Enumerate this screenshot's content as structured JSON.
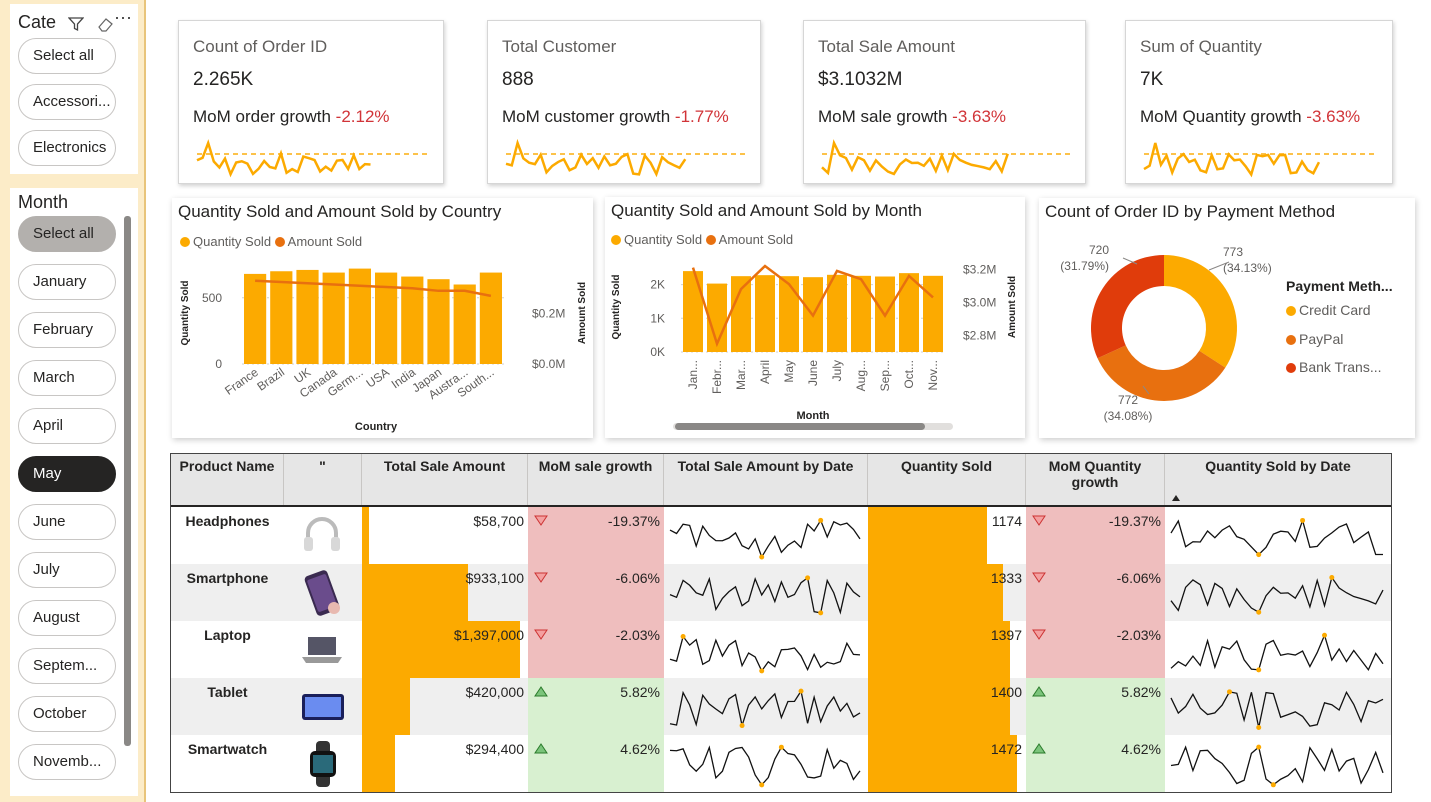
{
  "slicer_category": {
    "title": "Cate",
    "items": [
      "Select all",
      "Accessori...",
      "Electronics"
    ]
  },
  "slicer_month": {
    "title": "Month",
    "items": [
      "Select all",
      "January",
      "February",
      "March",
      "April",
      "May",
      "June",
      "July",
      "August",
      "Septem...",
      "October",
      "Novemb..."
    ],
    "selected": "May"
  },
  "cards": [
    {
      "label": "Count of Order ID",
      "value": "2.265K",
      "growth_label": "MoM order growth",
      "growth": "-2.12%"
    },
    {
      "label": "Total Customer",
      "value": "888",
      "growth_label": "MoM customer growth",
      "growth": "-1.77%"
    },
    {
      "label": "Total Sale Amount",
      "value": "$3.1032M",
      "growth_label": "MoM sale growth",
      "growth": "-3.63%"
    },
    {
      "label": "Sum of Quantity",
      "value": "7K",
      "growth_label": "MoM Quantity growth",
      "growth": "-3.63%"
    }
  ],
  "colors": {
    "quantity": "#fcaa00",
    "amount": "#e8700f",
    "bank": "#e03c0b",
    "neg": "#d13438",
    "neg_bg": "#efbebe",
    "pos_bg": "#d8f0d0"
  },
  "chart_country": {
    "title": "Quantity Sold and Amount Sold by Country",
    "legend": [
      "Quantity Sold",
      "Amount Sold"
    ],
    "xlabel": "Country",
    "ylabel_left": "Quantity Sold",
    "ylabel_right": "Amount Sold",
    "left_ticks": [
      "0",
      "500"
    ],
    "right_ticks": [
      "$0.0M",
      "$0.2M"
    ],
    "chart_data": {
      "type": "bar",
      "categories": [
        "France",
        "Brazil",
        "UK",
        "Canada",
        "Germ...",
        "USA",
        "India",
        "Japan",
        "Austra...",
        "South..."
      ],
      "series": [
        {
          "name": "Quantity Sold",
          "values": [
            680,
            700,
            710,
            690,
            720,
            690,
            660,
            640,
            600,
            690
          ]
        },
        {
          "name": "Amount Sold",
          "values": [
            0.33,
            0.325,
            0.32,
            0.315,
            0.31,
            0.305,
            0.3,
            0.29,
            0.29,
            0.27
          ]
        }
      ]
    }
  },
  "chart_month": {
    "title": "Quantity Sold and Amount Sold by Month",
    "legend": [
      "Quantity Sold",
      "Amount Sold"
    ],
    "xlabel": "Month",
    "ylabel_left": "Quantity Sold",
    "ylabel_right": "Amount Sold",
    "left_ticks": [
      "0K",
      "1K",
      "2K"
    ],
    "right_ticks": [
      "$2.8M",
      "$3.0M",
      "$3.2M"
    ],
    "chart_data": {
      "type": "bar",
      "categories": [
        "Jan...",
        "Febr...",
        "Mar...",
        "April",
        "May",
        "June",
        "July",
        "Aug...",
        "Sep...",
        "Oct...",
        "Nov..."
      ],
      "series": [
        {
          "name": "Quantity Sold",
          "values": [
            2400,
            2030,
            2250,
            2280,
            2250,
            2220,
            2290,
            2260,
            2240,
            2340,
            2260
          ]
        },
        {
          "name": "Amount Sold",
          "values": [
            3.21,
            2.75,
            3.08,
            3.22,
            3.11,
            2.92,
            3.19,
            3.14,
            2.92,
            3.16,
            3.03
          ]
        }
      ]
    }
  },
  "chart_payment": {
    "title": "Count of Order ID by Payment Method",
    "legend_title": "Payment Meth...",
    "labels": [
      "Credit Card",
      "PayPal",
      "Bank Trans..."
    ],
    "slice_labels": [
      {
        "count": "773",
        "pct": "(34.13%)"
      },
      {
        "count": "772",
        "pct": "(34.08%)"
      },
      {
        "count": "720",
        "pct": "(31.79%)"
      }
    ],
    "chart_data": {
      "type": "pie",
      "labels": [
        "Credit Card",
        "PayPal",
        "Bank Trans..."
      ],
      "values": [
        773,
        772,
        720
      ]
    }
  },
  "table": {
    "headers": [
      "Product Name",
      "\"",
      "Total Sale Amount",
      "MoM sale growth",
      "Total Sale Amount by Date",
      "Quantity Sold",
      "MoM Quantity growth",
      "Quantity Sold by Date"
    ],
    "rows": [
      {
        "name": "Headphones",
        "image": "headphones-icon",
        "amount": "$58,700",
        "amount_value": 58700,
        "growth": "-19.37%",
        "dir": "down",
        "qty": "1174",
        "qty_value": 1174,
        "qgrowth": "-19.37%"
      },
      {
        "name": "Smartphone",
        "image": "smartphone-icon",
        "amount": "$933,100",
        "amount_value": 933100,
        "growth": "-6.06%",
        "dir": "down",
        "qty": "1333",
        "qty_value": 1333,
        "qgrowth": "-6.06%"
      },
      {
        "name": "Laptop",
        "image": "laptop-icon",
        "amount": "$1,397,000",
        "amount_value": 1397000,
        "growth": "-2.03%",
        "dir": "down",
        "qty": "1397",
        "qty_value": 1397,
        "qgrowth": "-2.03%"
      },
      {
        "name": "Tablet",
        "image": "tablet-icon",
        "amount": "$420,000",
        "amount_value": 420000,
        "growth": "5.82%",
        "dir": "up",
        "qty": "1400",
        "qty_value": 1400,
        "qgrowth": "5.82%"
      },
      {
        "name": "Smartwatch",
        "image": "smartwatch-icon",
        "amount": "$294,400",
        "amount_value": 294400,
        "growth": "4.62%",
        "dir": "up",
        "qty": "1472",
        "qty_value": 1472,
        "qgrowth": "4.62%"
      }
    ]
  }
}
